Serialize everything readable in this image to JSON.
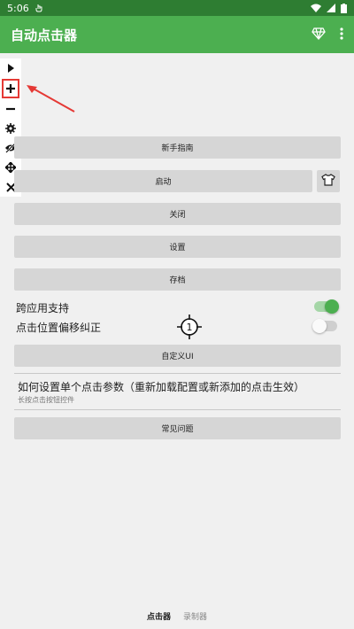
{
  "status_bar": {
    "time": "5:06"
  },
  "app_bar": {
    "title": "自动点击器"
  },
  "toolbar": {
    "tools": [
      "play-icon",
      "add-icon",
      "remove-icon",
      "settings-icon",
      "hide-icon",
      "move-icon",
      "close-icon"
    ]
  },
  "buttons": {
    "new_user_guide": "新手指南",
    "start": "启动",
    "stop": "关闭",
    "settings": "设置",
    "save": "存档",
    "custom_ui": "自定义UI",
    "faq": "常见问题"
  },
  "toggles": {
    "cross_app": {
      "label": "跨应用支持",
      "on": true
    },
    "offset_correction": {
      "label": "点击位置偏移纠正",
      "on": false
    }
  },
  "target_marker": {
    "number": "1"
  },
  "info": {
    "title": "如何设置单个点击参数（重新加载配置或新添加的点击生效）",
    "subtitle": "长按点击按钮控件"
  },
  "bottom_nav": {
    "tabs": [
      "点击器",
      "录制器"
    ],
    "active": "点击器"
  },
  "colors": {
    "primary": "#4caf50",
    "primary_dark": "#2e7d32",
    "annotation": "#e53935"
  }
}
